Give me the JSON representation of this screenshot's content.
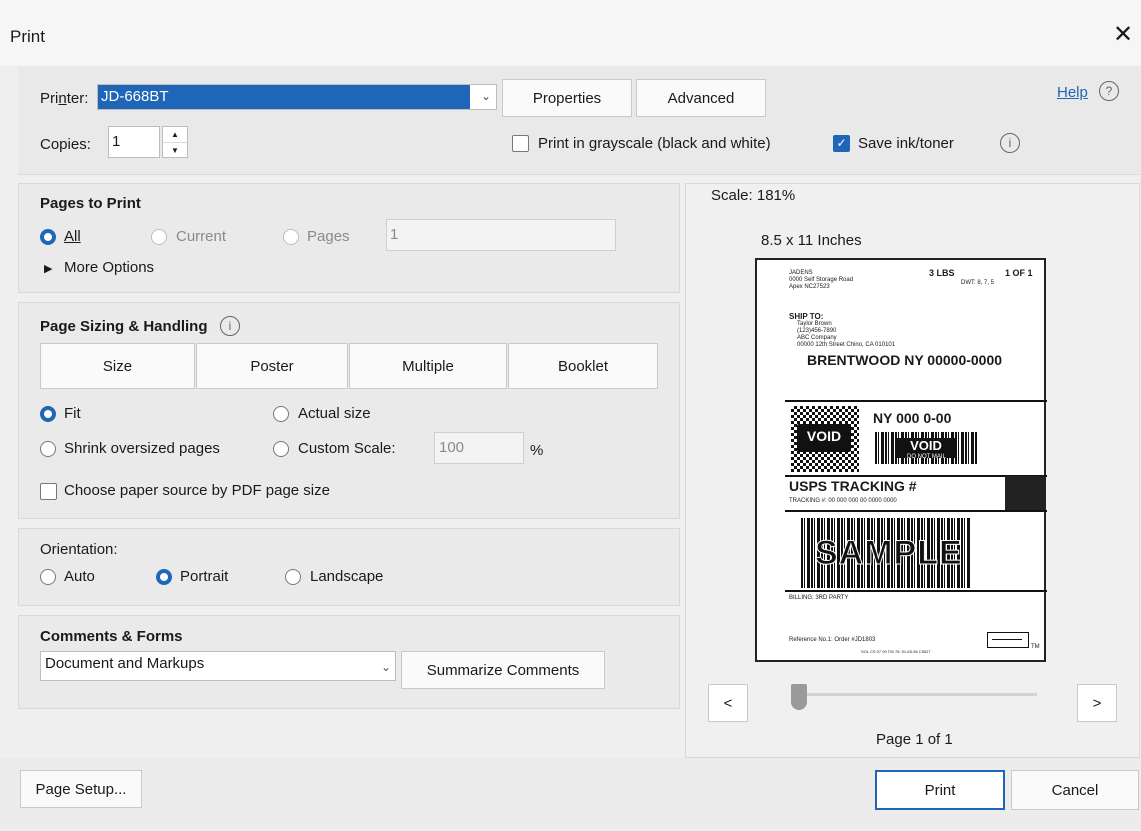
{
  "window": {
    "title": "Print",
    "close_glyph": "✕"
  },
  "printer": {
    "label_pre": "Pri",
    "label_ul": "n",
    "label_post": "ter:",
    "value": "JD-668BT",
    "properties_label": "Properties",
    "advanced_label": "Advanced",
    "help_label": "Help",
    "help_icon": "?"
  },
  "copies": {
    "label": "Copies:",
    "value": "1",
    "up": "▲",
    "down": "▼"
  },
  "grayscale": {
    "label": "Print in grayscale (black and white)",
    "checked": false
  },
  "save_ink": {
    "label": "Save ink/toner",
    "checked": true,
    "info_icon": "i"
  },
  "pages_to_print": {
    "header": "Pages to Print",
    "all_label": "All",
    "current_label": "Current",
    "pages_label": "Pages",
    "pages_value": "1",
    "more_options": "More Options",
    "more_options_arrow": "▶"
  },
  "sizing": {
    "header": "Page Sizing & Handling",
    "info_icon": "i",
    "tabs": [
      "Size",
      "Poster",
      "Multiple",
      "Booklet"
    ],
    "fit_label": "Fit",
    "actual_label": "Actual size",
    "shrink_label": "Shrink oversized pages",
    "custom_label": "Custom Scale:",
    "custom_value": "100",
    "percent": "%",
    "paper_source_label": "Choose paper source by PDF page size"
  },
  "orientation": {
    "header": "Orientation:",
    "auto_label": "Auto",
    "portrait_label": "Portrait",
    "landscape_label": "Landscape"
  },
  "comments": {
    "header": "Comments & Forms",
    "value": "Document and Markups",
    "summarize_label": "Summarize Comments"
  },
  "preview": {
    "scale": "Scale: 181%",
    "paper": "8.5 x 11 Inches",
    "prev": "<",
    "next": ">",
    "page_info": "Page 1 of 1",
    "label": {
      "from_name": "JADENS",
      "from_addr1": "0000 Self Storage Road",
      "from_addr2": "Apex NC27523",
      "weight": "3 LBS",
      "count": "1 OF 1",
      "dwt": "DWT: 8, 7, 5",
      "ship_to": "SHIP TO:",
      "to1": "Taylor Brown",
      "to2": "(123)456-7890",
      "to3": "ABC Company",
      "to4": "00000 12th Street Chino, CA 010101",
      "city": "BRENTWOOD  NY 00000-0000",
      "route": "NY 000 0-00",
      "void": "VOID",
      "void_sub": "DO NOT MAIL",
      "tracking_title": "USPS TRACKING #",
      "tracking_num": "TRACKING #: 00 000 000 00 0000 0000",
      "sample": "SAMPLE",
      "billing": "BILLING: 3RD PARTY",
      "reference": "Reference No.1: Order #JD1803",
      "footer_small": "SOL CS 07 09     TW 76: 51.6S.56 C5527",
      "tm": "TM"
    }
  },
  "footer": {
    "page_setup": "Page Setup...",
    "print": "Print",
    "cancel": "Cancel"
  }
}
